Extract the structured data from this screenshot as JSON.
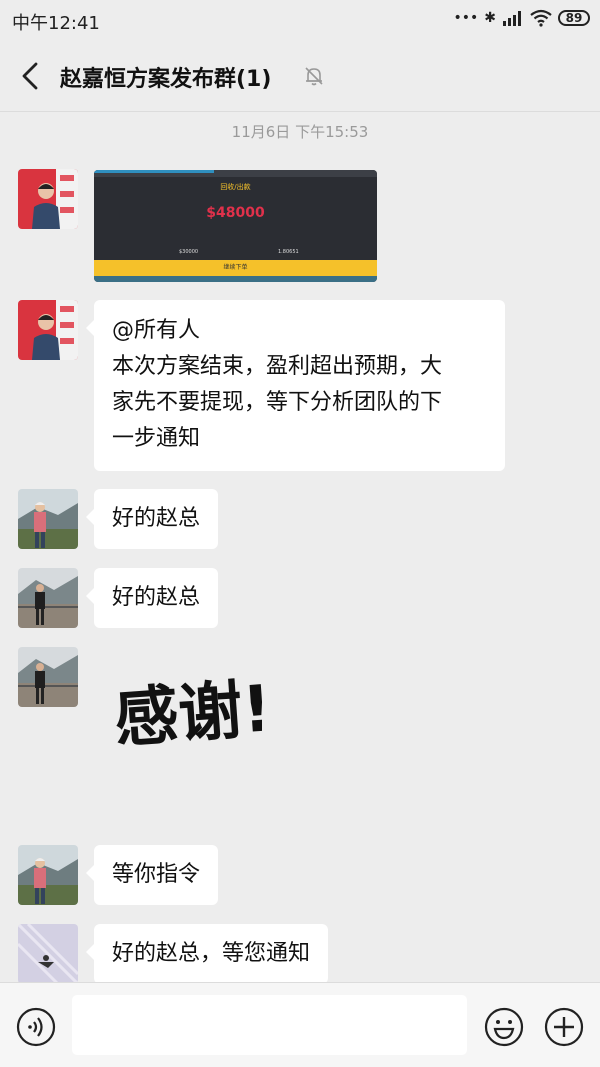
{
  "status": {
    "time": "中午12:41",
    "battery": "89"
  },
  "header": {
    "title": "赵嘉恒方案发布群(1)"
  },
  "chat": {
    "timestamp": "11月6日 下午15:53",
    "image_message": {
      "title": "回收/出款",
      "amount": "$48000",
      "left_value": "$30000",
      "right_value": "1.80651",
      "button": "继续下单"
    },
    "messages": [
      {
        "lines": [
          "@所有人",
          "本次方案结束，盈利超出预期，大",
          "家先不要提现，等下分析团队的下",
          "一步通知"
        ]
      },
      {
        "text": "好的赵总"
      },
      {
        "text": "好的赵总"
      },
      {
        "sticker": "感谢!"
      },
      {
        "text": "等你指令"
      },
      {
        "text": "好的赵总，等您通知"
      }
    ]
  },
  "input": {
    "value": ""
  },
  "colors": {
    "background": "#ededed",
    "bubble": "#ffffff",
    "accent_yellow": "#f5c12a",
    "amount_red": "#e0314b"
  }
}
